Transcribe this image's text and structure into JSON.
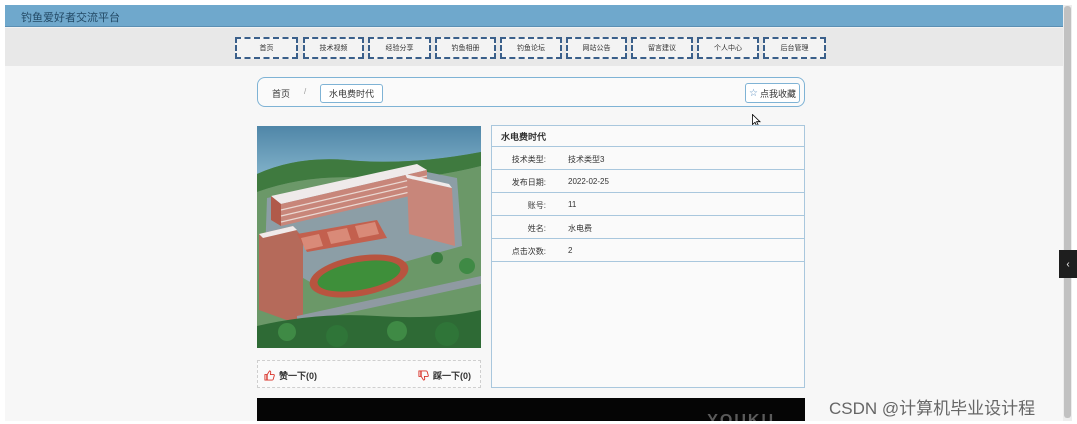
{
  "topbar": {
    "brand": "钓鱼爱好者交流平台"
  },
  "nav": [
    {
      "label": "首页"
    },
    {
      "label": "技术视频"
    },
    {
      "label": "经验分享"
    },
    {
      "label": "钓鱼相册"
    },
    {
      "label": "钓鱼论坛"
    },
    {
      "label": "网站公告"
    },
    {
      "label": "留言建议"
    },
    {
      "label": "个人中心"
    },
    {
      "label": "后台管理"
    }
  ],
  "breadcrumb": {
    "home": "首页",
    "separator": "/",
    "current": "水电费时代"
  },
  "favorite": {
    "label": "点我收藏",
    "icon": "star-icon"
  },
  "detail": {
    "title": "水电费时代",
    "rows": [
      {
        "key": "技术类型:",
        "value": "技术类型3"
      },
      {
        "key": "发布日期:",
        "value": "2022-02-25"
      },
      {
        "key": "账号:",
        "value": "11"
      },
      {
        "key": "姓名:",
        "value": "水电费"
      },
      {
        "key": "点击次数:",
        "value": "2"
      }
    ]
  },
  "votes": {
    "like": "赞一下(0)",
    "dislike": "踩一下(0)"
  },
  "video": {
    "logo": "YOUKU"
  },
  "side_handle": {
    "glyph": "‹"
  },
  "watermark": "CSDN @计算机毕业设计程",
  "colors": {
    "topbar": "#6fa8cc",
    "nav_border": "#3a5f8a",
    "panel_border": "#a9c7dd",
    "like_icon": "#d9342b"
  }
}
